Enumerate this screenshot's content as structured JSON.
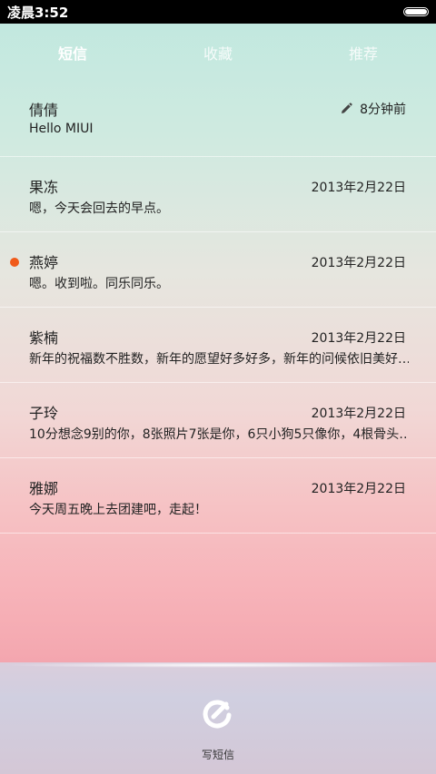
{
  "status_bar": {
    "time": "凌晨3:52"
  },
  "tabs": [
    {
      "label": "短信",
      "active": true
    },
    {
      "label": "收藏",
      "active": false
    },
    {
      "label": "推荐",
      "active": false
    }
  ],
  "conversations": [
    {
      "name": "倩倩",
      "preview": "Hello MIUI",
      "time": "8分钟前",
      "draft": true,
      "unread": false
    },
    {
      "name": "果冻",
      "preview": "嗯，今天会回去的早点。",
      "time": "2013年2月22日",
      "unread": false
    },
    {
      "name": "燕婷",
      "preview": "嗯。收到啦。同乐同乐。",
      "time": "2013年2月22日",
      "unread": true
    },
    {
      "name": "紫楠",
      "preview": "新年的祝福数不胜数，新年的愿望好多好多，新年的问候依旧美好…",
      "time": "2013年2月22日",
      "unread": false
    },
    {
      "name": "子玲",
      "preview": "10分想念9别的你，8张照片7张是你，6只小狗5只像你，4根骨头…",
      "time": "2013年2月22日",
      "unread": false
    },
    {
      "name": "雅娜",
      "preview": "今天周五晚上去团建吧，走起！",
      "time": "2013年2月22日",
      "unread": false
    }
  ],
  "compose": {
    "label": "写短信",
    "icon": "compose-icon"
  },
  "colors": {
    "unread_dot": "#f05a1a",
    "text": "#222222"
  }
}
